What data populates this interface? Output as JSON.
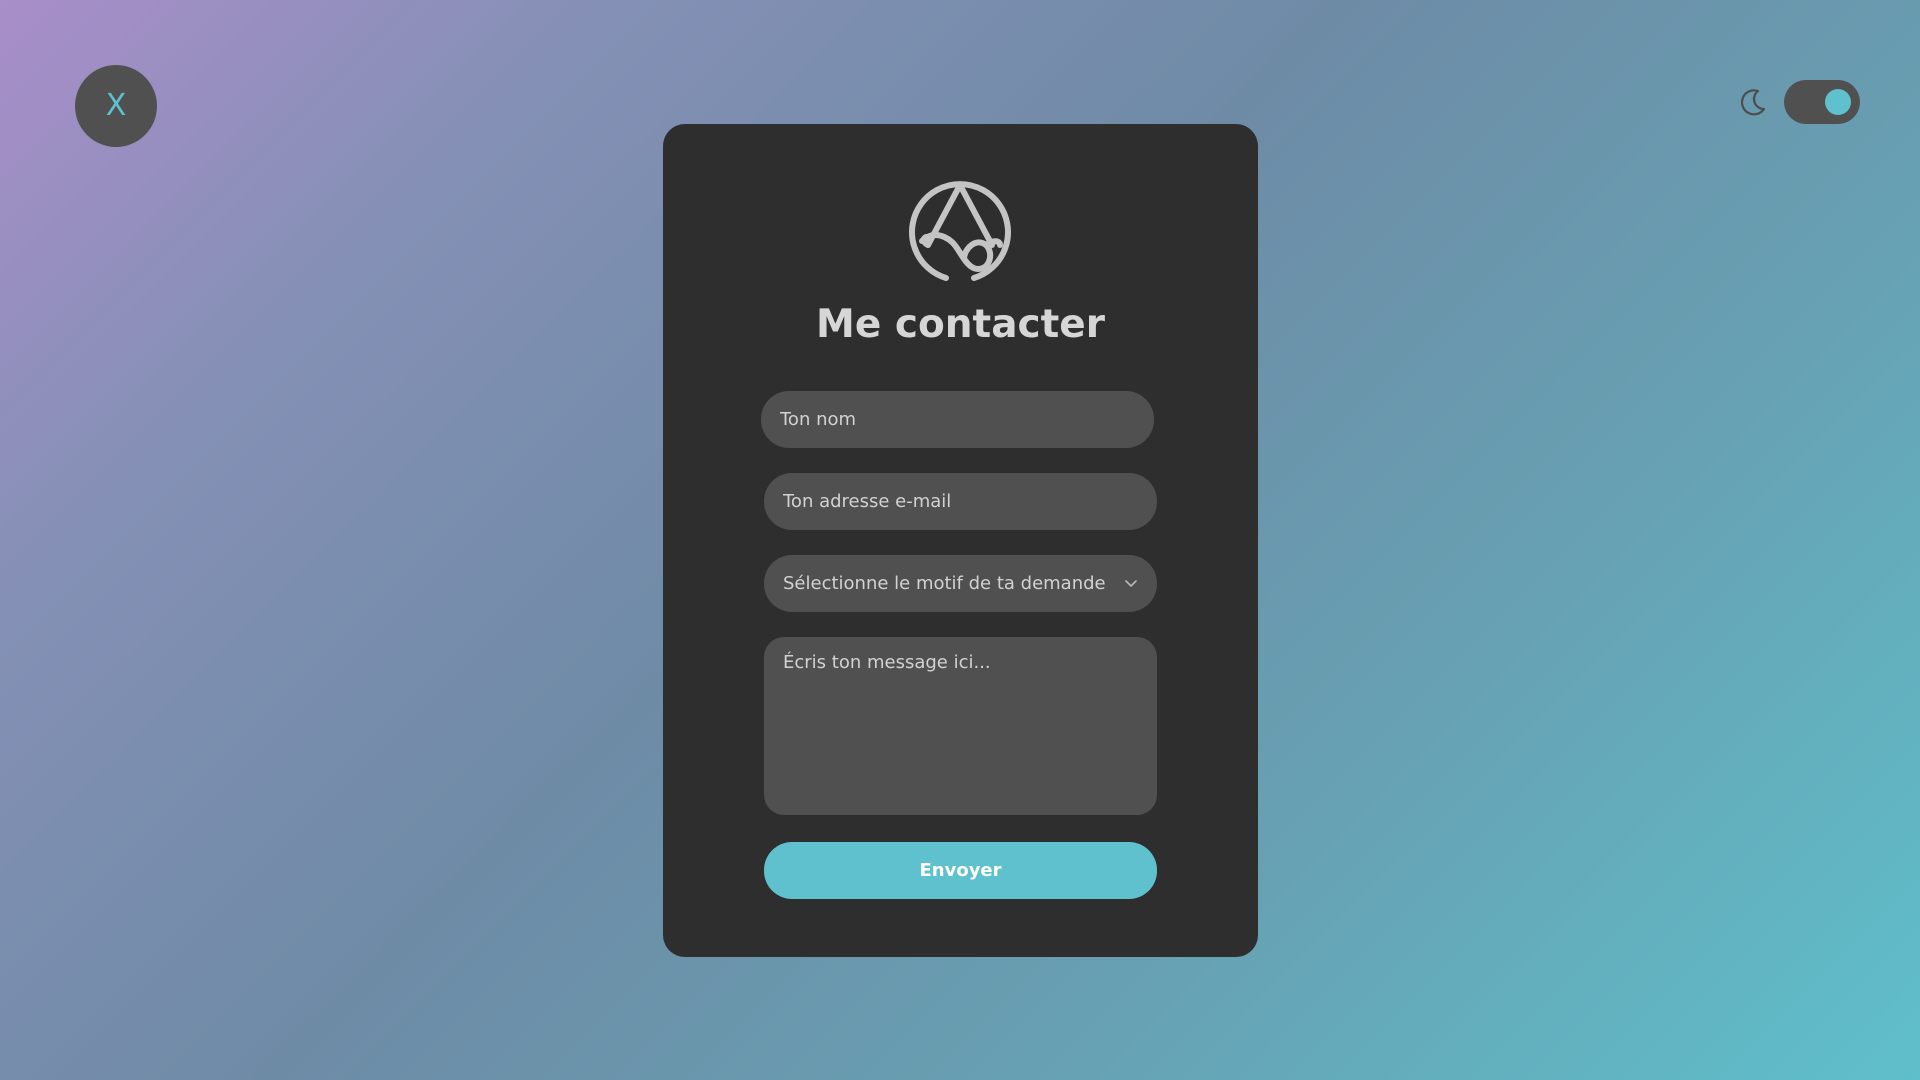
{
  "header": {
    "close_label": "X",
    "close_icon": "close-icon",
    "theme_icon": "moon-icon",
    "dark_mode_enabled": true
  },
  "form": {
    "logo_icon": "monogram-logo",
    "title": "Me contacter",
    "name_placeholder": "Ton nom",
    "email_placeholder": "Ton adresse e-mail",
    "reason_placeholder": "Sélectionne le motif de ta demande",
    "message_placeholder": "Écris ton message ici...",
    "submit_label": "Envoyer"
  },
  "colors": {
    "accent": "#5fc1cd",
    "card_background": "#2e2e2e",
    "field_background": "#505050",
    "text": "#d6d6d6"
  }
}
